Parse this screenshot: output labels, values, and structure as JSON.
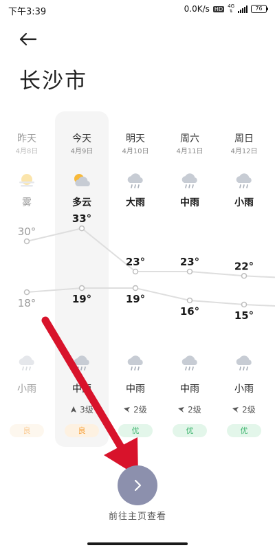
{
  "status_bar": {
    "time": "下午3:39",
    "net_speed": "0.0K/s",
    "hd": "HD",
    "network": "4G",
    "battery": "76"
  },
  "city": "长沙市",
  "days": [
    {
      "day": "昨天",
      "date": "4月8日",
      "cond": "雾",
      "cond_icon": "fog-icon",
      "high": "30°",
      "low": "18°",
      "night_cond": "小雨",
      "night_icon": "rain-cloud-icon",
      "wind": "",
      "aqi": "良",
      "past": true
    },
    {
      "day": "今天",
      "date": "4月9日",
      "cond": "多云",
      "cond_icon": "partly-cloudy-icon",
      "high": "33°",
      "low": "19°",
      "night_cond": "中雨",
      "night_icon": "rain-cloud-icon",
      "wind": "3级",
      "aqi": "良",
      "past": false
    },
    {
      "day": "明天",
      "date": "4月10日",
      "cond": "大雨",
      "cond_icon": "rain-cloud-icon",
      "high": "23°",
      "low": "19°",
      "night_cond": "中雨",
      "night_icon": "rain-cloud-icon",
      "wind": "2级",
      "aqi": "优",
      "past": false
    },
    {
      "day": "周六",
      "date": "4月11日",
      "cond": "中雨",
      "cond_icon": "rain-cloud-icon",
      "high": "23°",
      "low": "16°",
      "night_cond": "中雨",
      "night_icon": "rain-cloud-icon",
      "wind": "2级",
      "aqi": "优",
      "past": false
    },
    {
      "day": "周日",
      "date": "4月12日",
      "cond": "小雨",
      "cond_icon": "rain-cloud-icon",
      "high": "22°",
      "low": "15°",
      "night_cond": "小雨",
      "night_icon": "rain-cloud-icon",
      "wind": "2级",
      "aqi": "优",
      "past": false
    }
  ],
  "chart_data": {
    "type": "line",
    "categories": [
      "昨天",
      "今天",
      "明天",
      "周六",
      "周日"
    ],
    "series": [
      {
        "values": [
          30,
          33,
          23,
          23,
          22
        ]
      },
      {
        "values": [
          18,
          19,
          19,
          16,
          15
        ]
      }
    ]
  },
  "colors": {
    "aqi_good": "#f7a13a",
    "aqi_good_bg": "#fdf1e1",
    "aqi_excellent": "#3fb56f",
    "aqi_excellent_bg": "#e3f6ea",
    "button": "#8c90ad",
    "annotation": "#d8132b"
  },
  "next_page_label": "前往主页查看"
}
